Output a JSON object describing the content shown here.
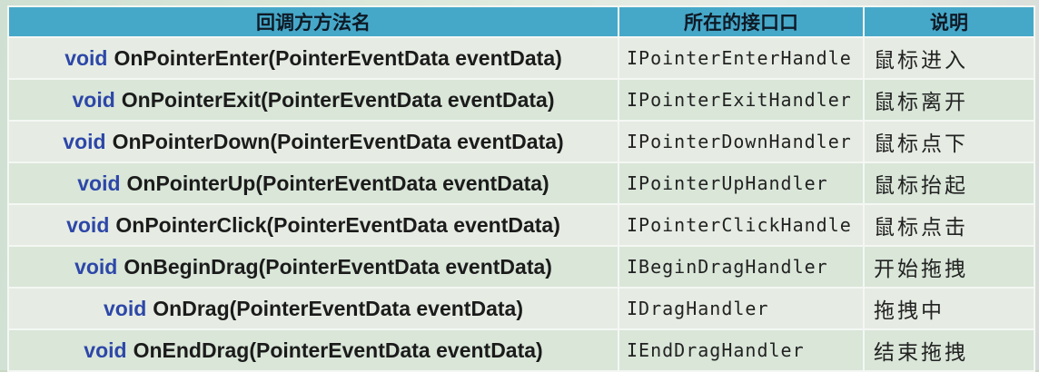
{
  "table": {
    "headers": [
      "回调方方法名",
      "所在的接口口",
      "说明"
    ],
    "rows": [
      {
        "keyword": "void",
        "method": "OnPointerEnter(PointerEventData eventData)",
        "interface": "IPointerEnterHandle",
        "description": "鼠标进入"
      },
      {
        "keyword": "void",
        "method": "OnPointerExit(PointerEventData eventData)",
        "interface": "IPointerExitHandler",
        "description": "鼠标离开"
      },
      {
        "keyword": "void",
        "method": "OnPointerDown(PointerEventData eventData)",
        "interface": "IPointerDownHandler",
        "description": "鼠标点下"
      },
      {
        "keyword": "void",
        "method": "OnPointerUp(PointerEventData eventData)",
        "interface": "IPointerUpHandler",
        "description": "鼠标抬起"
      },
      {
        "keyword": "void",
        "method": "OnPointerClick(PointerEventData eventData)",
        "interface": "IPointerClickHandle",
        "description": "鼠标点击"
      },
      {
        "keyword": "void",
        "method": "OnBeginDrag(PointerEventData eventData)",
        "interface": "IBeginDragHandler",
        "description": "开始拖拽"
      },
      {
        "keyword": "void",
        "method": "OnDrag(PointerEventData eventData)",
        "interface": "IDragHandler",
        "description": "拖拽中"
      },
      {
        "keyword": "void",
        "method": "OnEndDrag(PointerEventData eventData)",
        "interface": "IEndDragHandler",
        "description": "结束拖拽"
      }
    ]
  }
}
